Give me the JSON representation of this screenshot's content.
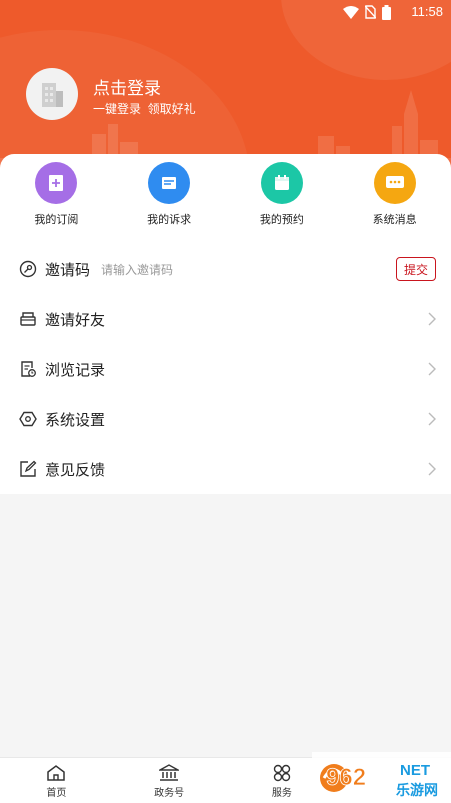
{
  "status_bar": {
    "time": "11:58",
    "icons": [
      "wifi-icon",
      "no-sim-icon",
      "battery-icon"
    ]
  },
  "profile": {
    "login_title": "点击登录",
    "login_subtitle": "一键登录  领取好礼"
  },
  "quick_actions": [
    {
      "label": "我的订阅",
      "icon": "subscription-icon",
      "color": "#a56ee6"
    },
    {
      "label": "我的诉求",
      "icon": "appeal-icon",
      "color": "#2f8cf0"
    },
    {
      "label": "我的预约",
      "icon": "calendar-icon",
      "color": "#1cc7a6"
    },
    {
      "label": "系统消息",
      "icon": "message-icon",
      "color": "#f5a711"
    }
  ],
  "invite_code": {
    "label": "邀请码",
    "placeholder": "请输入邀请码",
    "submit": "提交"
  },
  "menu": [
    {
      "label": "邀请好友",
      "icon": "invite-friends-icon"
    },
    {
      "label": "浏览记录",
      "icon": "history-icon"
    },
    {
      "label": "系统设置",
      "icon": "settings-icon"
    },
    {
      "label": "意见反馈",
      "icon": "feedback-icon"
    }
  ],
  "tabbar": [
    {
      "label": "首页",
      "icon": "home-icon"
    },
    {
      "label": "政务号",
      "icon": "government-icon"
    },
    {
      "label": "服务",
      "icon": "service-icon"
    }
  ],
  "watermark": {
    "text_main": "962",
    "text_side": "NET",
    "text_sub": "乐游网"
  },
  "colors": {
    "header": "#ee5a2b",
    "accent_red": "#c9151e",
    "background": "#f5f5f5"
  }
}
